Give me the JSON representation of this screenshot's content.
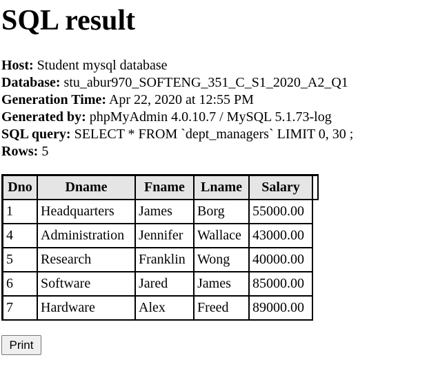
{
  "page_title": "SQL result",
  "meta": [
    {
      "label": "Host:",
      "value": "Student mysql database"
    },
    {
      "label": "Database:",
      "value": "stu_abur970_SOFTENG_351_C_S1_2020_A2_Q1"
    },
    {
      "label": "Generation Time:",
      "value": "Apr 22, 2020 at 12:55 PM"
    },
    {
      "label": "Generated by:",
      "value": "phpMyAdmin 4.0.10.7 / MySQL 5.1.73-log"
    },
    {
      "label": "SQL query:",
      "value": "SELECT * FROM `dept_managers` LIMIT 0, 30 ;"
    },
    {
      "label": "Rows:",
      "value": "5"
    }
  ],
  "table": {
    "headers": [
      "Dno",
      "Dname",
      "Fname",
      "Lname",
      "Salary"
    ],
    "rows": [
      [
        "1",
        "Headquarters",
        "James",
        "Borg",
        "55000.00"
      ],
      [
        "4",
        "Administration",
        "Jennifer",
        "Wallace",
        "43000.00"
      ],
      [
        "5",
        "Research",
        "Franklin",
        "Wong",
        "40000.00"
      ],
      [
        "6",
        "Software",
        "Jared",
        "James",
        "85000.00"
      ],
      [
        "7",
        "Hardware",
        "Alex",
        "Freed",
        "89000.00"
      ]
    ]
  },
  "print_button_label": "Print"
}
